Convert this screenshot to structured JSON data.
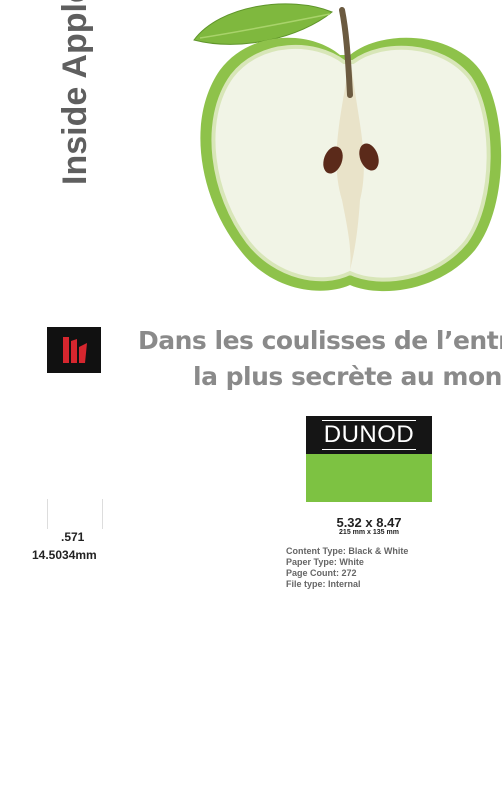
{
  "cover": {
    "spine_title": "Inside Apple",
    "subtitle_line1": "Dans les coulisses de l’entre",
    "subtitle_line2": "la plus secrète au mond",
    "publisher": "DUNOD",
    "publisher_logo_icon": "publisher-emblem-icon",
    "image_icon": "green-apple-half-icon"
  },
  "print_specs": {
    "spine_width_in": ".571",
    "spine_width_mm": "14.5034mm",
    "trim_size_in": "5.32 x 8.47",
    "trim_size_mm": "215 mm x 135 mm",
    "content_type": "Content Type: Black & White",
    "paper_type": "Paper Type: White",
    "page_count": "Page Count: 272",
    "file_type": "File type: Internal"
  },
  "colors": {
    "title_gray": "#5f5f5f",
    "subtitle_gray": "#8a8a8a",
    "dunod_black": "#151515",
    "dunod_green": "#7dc242",
    "logo_red": "#d6262e",
    "apple_green": "#8ec24a"
  }
}
